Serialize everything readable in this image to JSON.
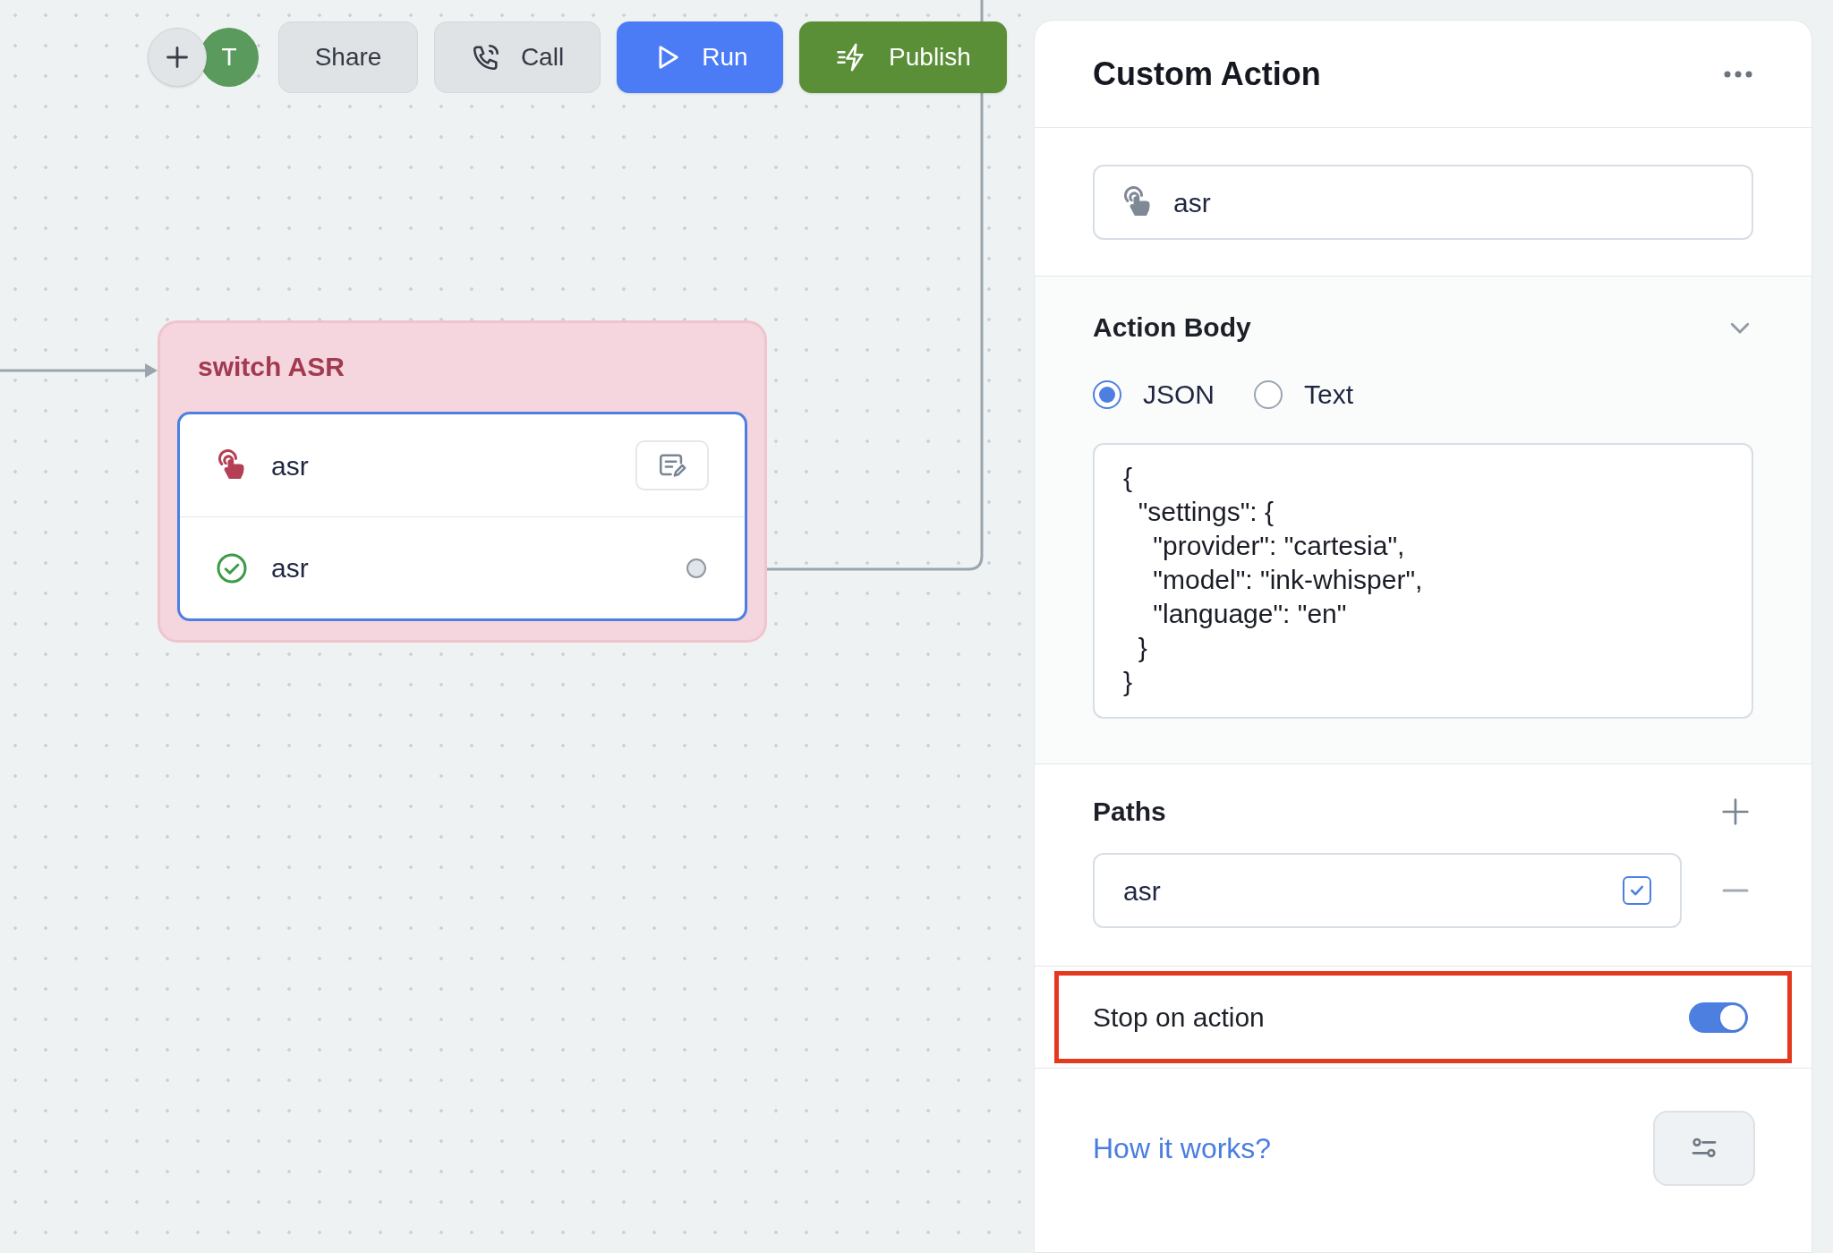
{
  "toolbar": {
    "avatar": "T",
    "buttons": [
      {
        "label": "Share",
        "kind": "plain"
      },
      {
        "label": "Call",
        "kind": "call"
      },
      {
        "label": "Run",
        "kind": "run"
      },
      {
        "label": "Publish",
        "kind": "publish"
      }
    ]
  },
  "node": {
    "title": "switch ASR",
    "rows": [
      {
        "kind": "action",
        "label": "asr"
      },
      {
        "kind": "path",
        "label": "asr"
      }
    ]
  },
  "panel": {
    "title": "Custom Action",
    "name_field": {
      "value": "asr"
    },
    "action_body": {
      "title": "Action Body",
      "formats": [
        {
          "label": "JSON",
          "selected": true
        },
        {
          "label": "Text",
          "selected": false
        }
      ],
      "body_lines": [
        "{",
        "  \"settings\": {",
        "    \"provider\": \"cartesia\",",
        "    \"model\": \"ink-whisper\",",
        "    \"language\": \"en\"",
        "  }",
        "}"
      ]
    },
    "paths": {
      "title": "Paths",
      "items": [
        {
          "value": "asr",
          "checked": true
        }
      ]
    },
    "stop_on_action": {
      "label": "Stop on action",
      "on": true
    },
    "help_link": "How it works?"
  }
}
